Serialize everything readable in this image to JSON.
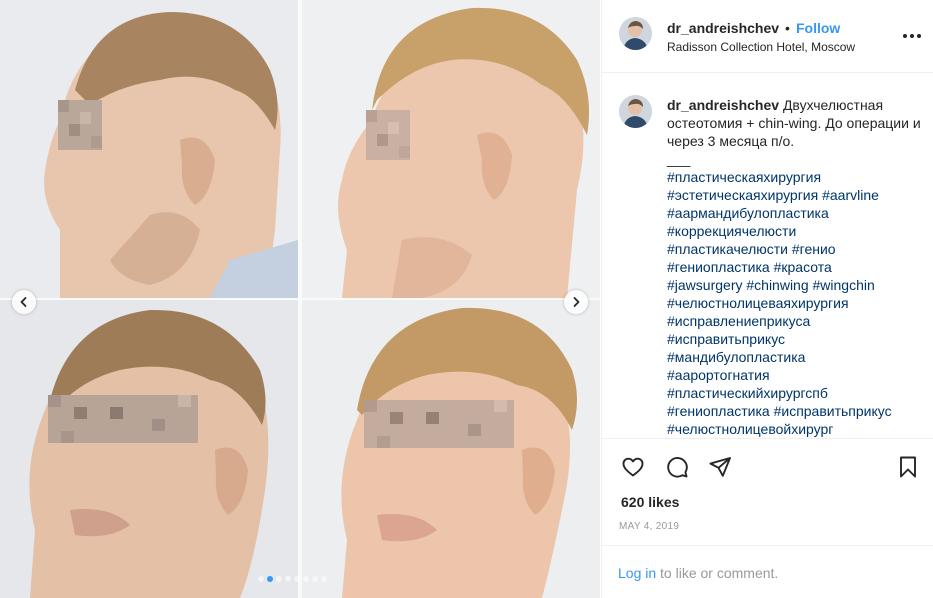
{
  "post": {
    "carousel": {
      "slide_count": 8,
      "active_slide": 1
    },
    "author": {
      "username": "dr_andreishchev",
      "separator": "•",
      "follow_label": "Follow",
      "location": "Radisson Collection Hotel, Moscow"
    },
    "caption": {
      "username": "dr_andreishchev",
      "text": "Двухчелюстная остеотомия + chin-wing. До операции и через 3 месяца п/о.",
      "divider": "___",
      "hashtag_lines": [
        "#пластическаяхирургия",
        "#эстетическаяхирургия #aarvline",
        "#аармандибулопластика",
        "#коррекциячелюсти",
        "#пластикачелюсти #генио",
        "#гениопластика #красота",
        "#jawsurgery #chinwing #wingchin",
        "#челюстнолицеваяхирургия",
        "#исправлениеприкуса",
        "#исправитьприкус",
        "#мандибулопластика",
        "#аарортогнатия",
        "#пластическийхирургспб",
        "#гениопластика #исправитьприкус",
        "#челюстнолицевойхирург"
      ]
    },
    "likes_text": "620 likes",
    "date_text": "MAY 4, 2019",
    "login_prompt": {
      "link": "Log in",
      "rest": " to like or comment."
    }
  },
  "icons": [
    "heart-icon",
    "comment-icon",
    "share-icon",
    "bookmark-icon",
    "more-options-icon",
    "chevron-left-icon",
    "chevron-right-icon"
  ],
  "colors": {
    "link_blue": "#3897f0",
    "hashtag": "#003569",
    "muted": "#999999",
    "border": "#efefef"
  }
}
